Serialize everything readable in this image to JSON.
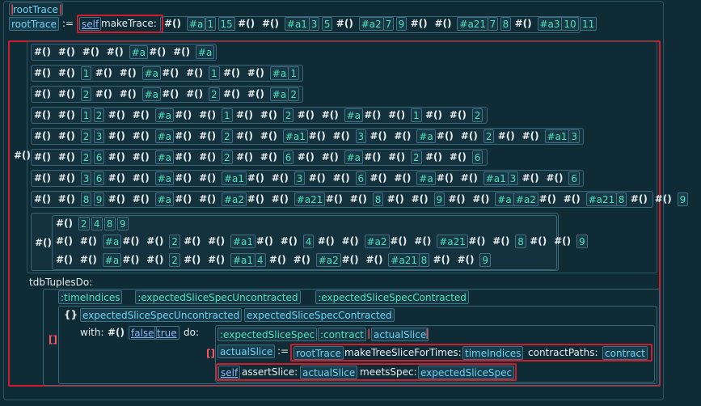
{
  "header": {
    "var": "rootTrace"
  },
  "assign": {
    "target": "rootTrace",
    "op": ":=",
    "receiver": "self",
    "selector": "makeTrace:",
    "arg_tokens": [
      "#()",
      "#a",
      "1",
      "15",
      "#()",
      "#()",
      "#a1",
      "3",
      "5",
      "#()",
      "#a2",
      "7",
      "9",
      "#()",
      "#()",
      "#a21",
      "7",
      "8",
      "#()",
      "#a3",
      "10",
      "11"
    ]
  },
  "outer_hash": "#()",
  "rows": [
    [
      "#()",
      "#()",
      "#()",
      "#()",
      "#a",
      "#()",
      "#()",
      "#a"
    ],
    [
      "#()",
      "#()",
      "1",
      "#()",
      "#()",
      "#a",
      "#()",
      "#()",
      "1",
      "#()",
      "#()",
      "#a",
      "1"
    ],
    [
      "#()",
      "#()",
      "2",
      "#()",
      "#()",
      "#a",
      "#()",
      "#()",
      "2",
      "#()",
      "#()",
      "#a",
      "2"
    ],
    [
      "#()",
      "#()",
      "1",
      "2",
      "#()",
      "#()",
      "#a",
      "#()",
      "#()",
      "1",
      "#()",
      "#()",
      "2",
      "#()",
      "#()",
      "#a",
      "#()",
      "#()",
      "1",
      "#()",
      "#()",
      "2"
    ],
    [
      "#()",
      "#()",
      "2",
      "3",
      "#()",
      "#()",
      "#a",
      "#()",
      "#()",
      "2",
      "#()",
      "#()",
      "#a1",
      "#()",
      "#()",
      "3",
      "#()",
      "#()",
      "#a",
      "#()",
      "#()",
      "2",
      "#()",
      "#()",
      "#a1",
      "3"
    ],
    [
      "#()",
      "#()",
      "2",
      "6",
      "#()",
      "#()",
      "#a",
      "#()",
      "#()",
      "2",
      "#()",
      "#()",
      "6",
      "#()",
      "#()",
      "#a",
      "#()",
      "#()",
      "2",
      "#()",
      "#()",
      "6"
    ],
    [
      "#()",
      "#()",
      "3",
      "6",
      "#()",
      "#()",
      "#a",
      "#()",
      "#()",
      "#a1",
      "#()",
      "#()",
      "3",
      "#()",
      "#()",
      "6",
      "#()",
      "#()",
      "#a",
      "#()",
      "#()",
      "#a1",
      "3",
      "#()",
      "#()",
      "6"
    ],
    [
      "#()",
      "#()",
      "8",
      "9",
      "#()",
      "#()",
      "#a",
      "#()",
      "#()",
      "#a2",
      "#()",
      "#()",
      "#a21",
      "#()",
      "#()",
      "8",
      "#()",
      "#()",
      "9",
      "#()",
      "#()",
      "#a",
      "#a2",
      "#()",
      "#()",
      "#a21",
      "8",
      "#()",
      "#()",
      "9"
    ]
  ],
  "block_row": {
    "hash": "#()",
    "line1": [
      "#()",
      "2",
      "4",
      "8",
      "9"
    ],
    "line2": [
      "#()",
      "#()",
      "#a",
      "#()",
      "#()",
      "2",
      "#()",
      "#()",
      "#a1",
      "#()",
      "#()",
      "4",
      "#()",
      "#()",
      "#a2",
      "#()",
      "#()",
      "#a21",
      "#()",
      "#()",
      "8",
      "#()",
      "#()",
      "9"
    ],
    "line3": [
      "#()",
      "#()",
      "#a",
      "#()",
      "#()",
      "2",
      "#()",
      "#()",
      "#a1",
      "4",
      "#()",
      "#()",
      "#a2",
      "#()",
      "#()",
      "#a21",
      "8",
      "#()",
      "#()",
      "9"
    ]
  },
  "tdb": {
    "keyword": "tdbTuplesDo:",
    "block_args": [
      ":timeIndices",
      ":expectedSliceSpecUncontracted",
      ":expectedSliceSpecContracted"
    ],
    "brace": "{}",
    "brace_items": [
      "expectedSliceSpecUncontracted",
      "expectedSliceSpecContracted"
    ],
    "bracket": "[]",
    "with_kw": "with:",
    "with_tokens": [
      "#()",
      "false",
      "true"
    ],
    "do_kw": "do:",
    "inner_args": [
      ":expectedSliceSpec",
      ":contract",
      "actualSlice"
    ],
    "inner_bracket": "[]",
    "stmt1": {
      "target": "actualSlice",
      "op": ":=",
      "receiver": "rootTrace",
      "sel1": "makeTreeSliceForTimes:",
      "arg1": "timeIndices",
      "sel2": "contractPaths:",
      "arg2": "contract"
    },
    "stmt2": {
      "receiver": "self",
      "sel1": "assertSlice:",
      "arg1": "actualSlice",
      "sel2": "meetsSpec:",
      "arg2": "expectedSliceSpec"
    }
  },
  "colors": {
    "background": "#0f2b36",
    "highlight": "#d01c2a",
    "identifier": "#6fd2f4",
    "literal": "#4fe0c0"
  }
}
